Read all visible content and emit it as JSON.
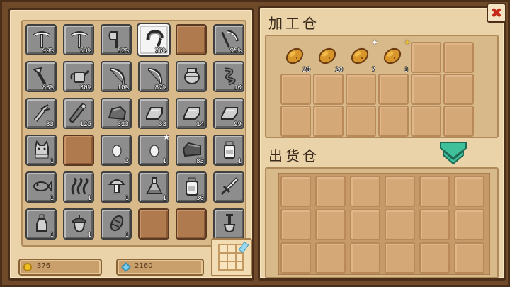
{
  "colors": {
    "accent": "#3fbf9a",
    "close": "#c42a1a",
    "gold": "#f0c020",
    "gem": "#7ad0f0"
  },
  "inventory": [
    {
      "icon": "pickaxe-icon",
      "qty": "99%"
    },
    {
      "icon": "pickaxe-icon",
      "qty": "53%"
    },
    {
      "icon": "axe-icon",
      "qty": "52%"
    },
    {
      "icon": "sickle-icon",
      "qty": "26%",
      "selected": true
    },
    {
      "icon": "",
      "qty": "",
      "empty": true
    },
    {
      "icon": "scythe-icon",
      "qty": "95%"
    },
    {
      "icon": "hoe-icon",
      "qty": "83%"
    },
    {
      "icon": "watering-can-icon",
      "qty": "30%"
    },
    {
      "icon": "bow-icon",
      "qty": "10%"
    },
    {
      "icon": "bow-icon",
      "qty": "87%"
    },
    {
      "icon": "pot-icon",
      "qty": ""
    },
    {
      "icon": "rope-icon",
      "qty": "10"
    },
    {
      "icon": "herb-bundle-icon",
      "qty": "33"
    },
    {
      "icon": "log-icon",
      "qty": "125"
    },
    {
      "icon": "stone-icon",
      "qty": "323"
    },
    {
      "icon": "ingot-icon",
      "qty": "33"
    },
    {
      "icon": "ingot-icon",
      "qty": "14"
    },
    {
      "icon": "ingot-icon",
      "qty": "99"
    },
    {
      "icon": "cat-icon",
      "qty": "1"
    },
    {
      "icon": "",
      "qty": "",
      "empty": true
    },
    {
      "icon": "egg-icon",
      "qty": "2"
    },
    {
      "icon": "egg-icon",
      "qty": "1",
      "star": true
    },
    {
      "icon": "bread-loaf-icon",
      "qty": "83"
    },
    {
      "icon": "milk-bottle-icon",
      "qty": "1"
    },
    {
      "icon": "fish-icon",
      "qty": "1"
    },
    {
      "icon": "seaweed-icon",
      "qty": "1"
    },
    {
      "icon": "mushroom-icon",
      "qty": "1"
    },
    {
      "icon": "flask-icon",
      "qty": "1"
    },
    {
      "icon": "jar-icon",
      "qty": "30"
    },
    {
      "icon": "sword-icon",
      "qty": ""
    },
    {
      "icon": "bottle-icon",
      "qty": "1"
    },
    {
      "icon": "acorn-icon",
      "qty": "1"
    },
    {
      "icon": "pinecone-icon",
      "qty": "1"
    },
    {
      "icon": "",
      "qty": "",
      "empty": true
    },
    {
      "icon": "",
      "qty": "",
      "empty": true
    },
    {
      "icon": "shovel-icon",
      "qty": ""
    }
  ],
  "currency": {
    "coins": "376",
    "gems": "2160"
  },
  "processing": {
    "title": "加工仓",
    "slots": [
      {
        "icon": "potato-icon",
        "qty": "20"
      },
      {
        "icon": "potato-icon",
        "qty": "20"
      },
      {
        "icon": "potato-icon",
        "qty": "7",
        "star": "white"
      },
      {
        "icon": "potato-icon",
        "qty": "3",
        "star": "gold"
      }
    ]
  },
  "shipping": {
    "title": "出货仓"
  }
}
